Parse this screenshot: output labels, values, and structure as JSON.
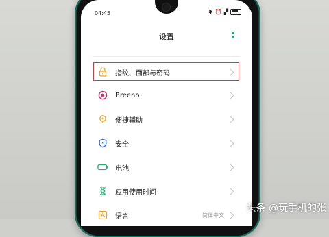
{
  "status_bar": {
    "time": "04:45"
  },
  "header": {
    "title": "设置"
  },
  "settings_items": [
    {
      "label": "指纹、面部与密码",
      "icon": "lock-icon",
      "color": "#f0a020",
      "value": ""
    },
    {
      "label": "Breeno",
      "icon": "breeno-icon",
      "color": "#c0306a",
      "value": ""
    },
    {
      "label": "便捷辅助",
      "icon": "hand-icon",
      "color": "#f0a020",
      "value": ""
    },
    {
      "label": "安全",
      "icon": "shield-icon",
      "color": "#2f6fd6",
      "value": ""
    },
    {
      "label": "电池",
      "icon": "battery-icon",
      "color": "#22b070",
      "value": ""
    },
    {
      "label": "应用使用时间",
      "icon": "hourglass-icon",
      "color": "#22b070",
      "value": ""
    },
    {
      "label": "语言",
      "icon": "language-icon",
      "color": "#f0a020",
      "value": "简体中文"
    }
  ],
  "watermark": "头条 @玩手机的张"
}
